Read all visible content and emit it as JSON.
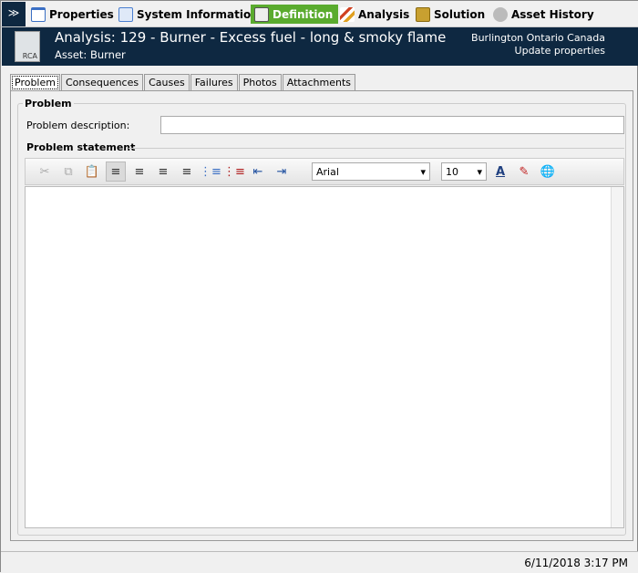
{
  "nav": {
    "items": [
      {
        "label": "Properties",
        "icon": "properties-icon",
        "color": "#3a6fc4"
      },
      {
        "label": "System Information",
        "icon": "document-icon",
        "color": "#4a7fd0"
      },
      {
        "label": "Definition",
        "icon": "rca-icon",
        "color": "#ffffff",
        "active": true
      },
      {
        "label": "Analysis",
        "icon": "analysis-icon",
        "color": "#d04020"
      },
      {
        "label": "Solution",
        "icon": "solution-icon",
        "color": "#c8a030"
      },
      {
        "label": "Asset History",
        "icon": "gear-icon",
        "color": "#888888"
      }
    ],
    "collapse": "»"
  },
  "header": {
    "title": "Analysis: 129 - Burner - Excess fuel - long & smoky flame",
    "asset": "Asset: Burner",
    "location": "Burlington Ontario Canada",
    "update_link": "Update properties",
    "icon_text": "RCA"
  },
  "tabs": [
    "Problem",
    "Consequences",
    "Causes",
    "Failures",
    "Photos",
    "Attachments"
  ],
  "problem": {
    "group_label": "Problem",
    "description_label": "Problem description:",
    "description_value": "",
    "statement_label": "Problem statement"
  },
  "toolbar": {
    "font": "Arial",
    "size": "10"
  },
  "status": {
    "datetime": "6/11/2018 3:17 PM"
  }
}
